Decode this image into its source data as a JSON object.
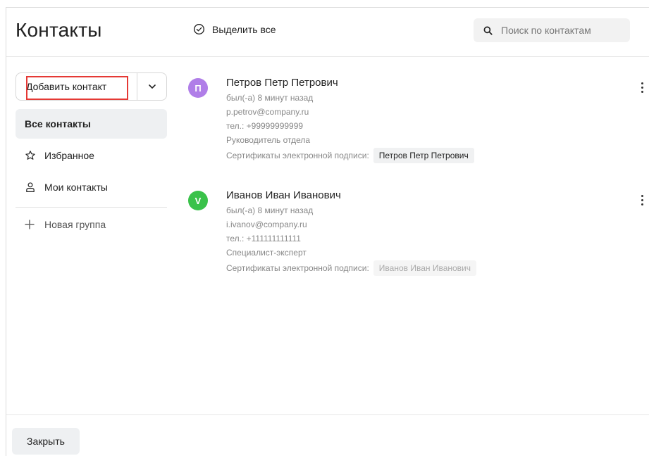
{
  "header": {
    "title": "Контакты",
    "select_all_label": "Выделить все",
    "search_placeholder": "Поиск по контактам"
  },
  "sidebar": {
    "add_contact_label": "Добавить контакт",
    "items": [
      {
        "label": "Все контакты",
        "icon": "none",
        "active": true
      },
      {
        "label": "Избранное",
        "icon": "star-icon",
        "active": false
      },
      {
        "label": "Мои контакты",
        "icon": "user-icon",
        "active": false
      }
    ],
    "new_group_label": "Новая группа"
  },
  "contacts": [
    {
      "initial": "П",
      "avatar_color": "#b07ee8",
      "name": "Петров Петр Петрович",
      "status": "был(-а) 8 минут назад",
      "email": "p.petrov@company.ru",
      "phone": "тел.: +99999999999",
      "position": "Руководитель отдела",
      "certs_label": "Сертификаты электронной подписи:",
      "cert_name": "Петров Петр Петрович"
    },
    {
      "initial": "V",
      "avatar_color": "#3ac24a",
      "name": "Иванов Иван Иванович",
      "status": "был(-а) 8 минут назад",
      "email": "i.ivanov@company.ru",
      "phone": "тел.: +111111111111",
      "position": "Специалист-эксперт",
      "certs_label": "Сертификаты электронной подписи:",
      "cert_name": "Иванов Иван Иванович"
    }
  ],
  "footer": {
    "close_label": "Закрыть"
  }
}
